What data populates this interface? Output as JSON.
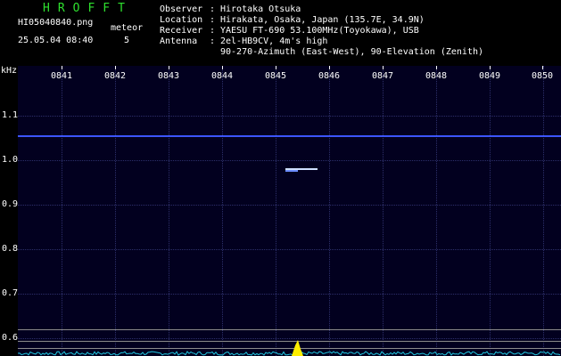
{
  "header": {
    "app_title": "HROFFT",
    "file_name": "HI05040840.png",
    "datetime": "25.05.04 08:40",
    "meteor_label": "meteor",
    "meteor_count": "5"
  },
  "info": {
    "observer_key": "Observer",
    "observer_value": "Hirotaka Otsuka",
    "location_key": "Location",
    "location_value": "Hirakata, Osaka, Japan (135.7E, 34.9N)",
    "receiver_key": "Receiver",
    "receiver_value": "YAESU FT-690 53.100MHz(Toyokawa), USB",
    "antenna_key": "Antenna",
    "antenna_value": "2el-HB9CV, 4m's high",
    "antenna_value2": "90-270-Azimuth (East-West), 90-Elevation (Zenith)"
  },
  "axis": {
    "unit": "kHz",
    "freq_labels": [
      "1.1",
      "1.0",
      "0.9",
      "0.8",
      "0.7",
      "0.6"
    ],
    "time_labels": [
      "0841",
      "0842",
      "0843",
      "0844",
      "0845",
      "0846",
      "0847",
      "0848",
      "0849",
      "0850"
    ]
  },
  "colors": {
    "title_green": "#2ee02e",
    "background": "#02001f",
    "carrier_blue": "#3c55ff",
    "spectrum_cyan": "#20c8e0",
    "spectrum_yellow": "#ffee00"
  }
}
